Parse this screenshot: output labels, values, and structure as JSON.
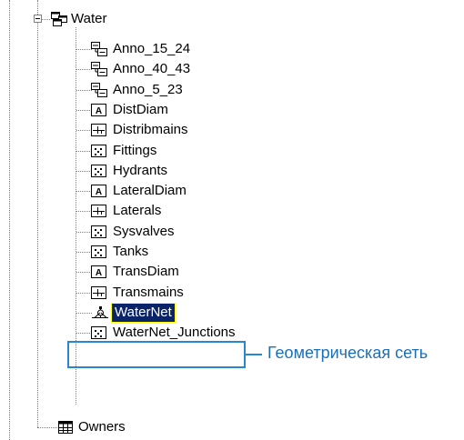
{
  "tree": {
    "parent": {
      "label": "Water",
      "icon": "feature-dataset-icon",
      "expanded": true
    },
    "children": [
      {
        "label": "Anno_15_24",
        "icon": "annotation-class-icon"
      },
      {
        "label": "Anno_40_43",
        "icon": "annotation-class-icon"
      },
      {
        "label": "Anno_5_23",
        "icon": "annotation-class-icon"
      },
      {
        "label": "DistDiam",
        "icon": "dimension-class-icon"
      },
      {
        "label": "Distribmains",
        "icon": "line-feature-class-icon"
      },
      {
        "label": "Fittings",
        "icon": "point-feature-class-icon"
      },
      {
        "label": "Hydrants",
        "icon": "point-feature-class-icon"
      },
      {
        "label": "LateralDiam",
        "icon": "dimension-class-icon"
      },
      {
        "label": "Laterals",
        "icon": "line-feature-class-icon"
      },
      {
        "label": "Sysvalves",
        "icon": "point-feature-class-icon"
      },
      {
        "label": "Tanks",
        "icon": "point-feature-class-icon"
      },
      {
        "label": "TransDiam",
        "icon": "dimension-class-icon"
      },
      {
        "label": "Transmains",
        "icon": "line-feature-class-icon"
      },
      {
        "label": "WaterNet",
        "icon": "geometric-network-icon",
        "selected": true
      },
      {
        "label": "WaterNet_Junctions",
        "icon": "point-feature-class-icon"
      }
    ],
    "sibling": {
      "label": "Owners",
      "icon": "table-icon"
    }
  },
  "callout": {
    "text": "Геометрическая сеть",
    "color": "#2a86d1"
  },
  "colors": {
    "selection_bg": "#0a246a",
    "selection_fg": "#ffffff",
    "tree_line": "#808080"
  }
}
